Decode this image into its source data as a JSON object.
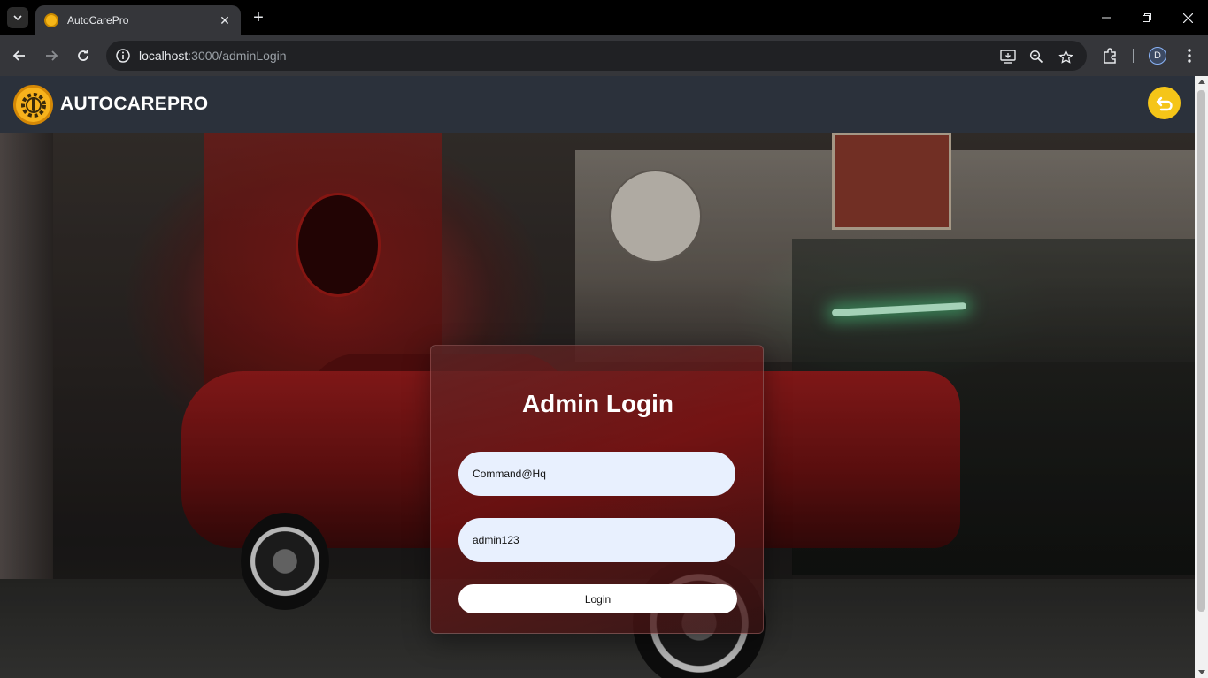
{
  "browser": {
    "tab_title": "AutoCarePro",
    "url_host": "localhost",
    "url_path": ":3000/adminLogin",
    "profile_initial": "D"
  },
  "header": {
    "brand": "AUTOCAREPRO",
    "accent_color": "#f5c518"
  },
  "login": {
    "title": "Admin Login",
    "username_value": "Command@Hq",
    "password_value": "admin123",
    "submit_label": "Login"
  }
}
